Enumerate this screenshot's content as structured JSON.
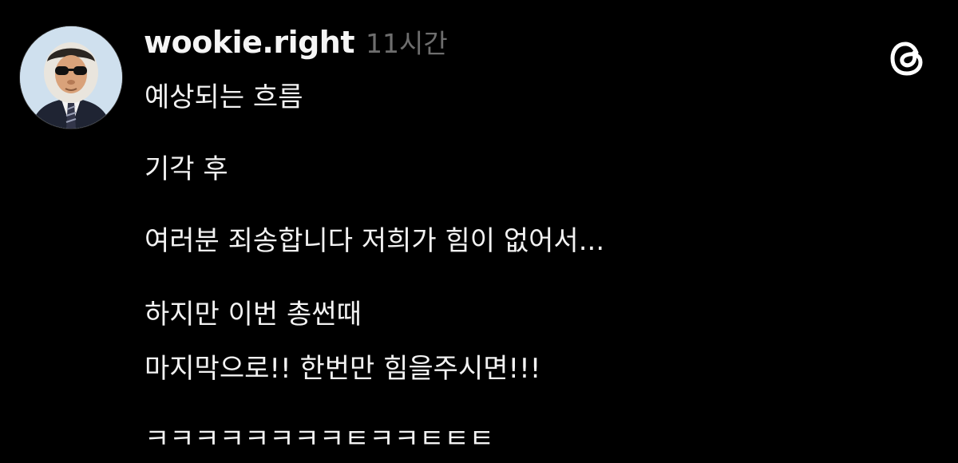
{
  "post": {
    "author": {
      "username": "wookie.right",
      "avatar_description": "avatar"
    },
    "timestamp": "11시간",
    "lines": [
      "예상되는 흐름",
      "기각 후",
      "여러분 죄송합니다 저희가 힘이 없어서...",
      "하지만 이번 총썬때",
      "마지막으로!! 한번만 힘을주시면!!!",
      "ㅋㅋㅋㅋㅋㅋㅋㅋㅌㅋㅋㅌㅌㅌ"
    ]
  },
  "icons": {
    "app_logo": "threads-logo-icon"
  },
  "colors": {
    "background": "#000000",
    "text": "#f2f2f2",
    "timestamp": "#6e6e6e"
  }
}
